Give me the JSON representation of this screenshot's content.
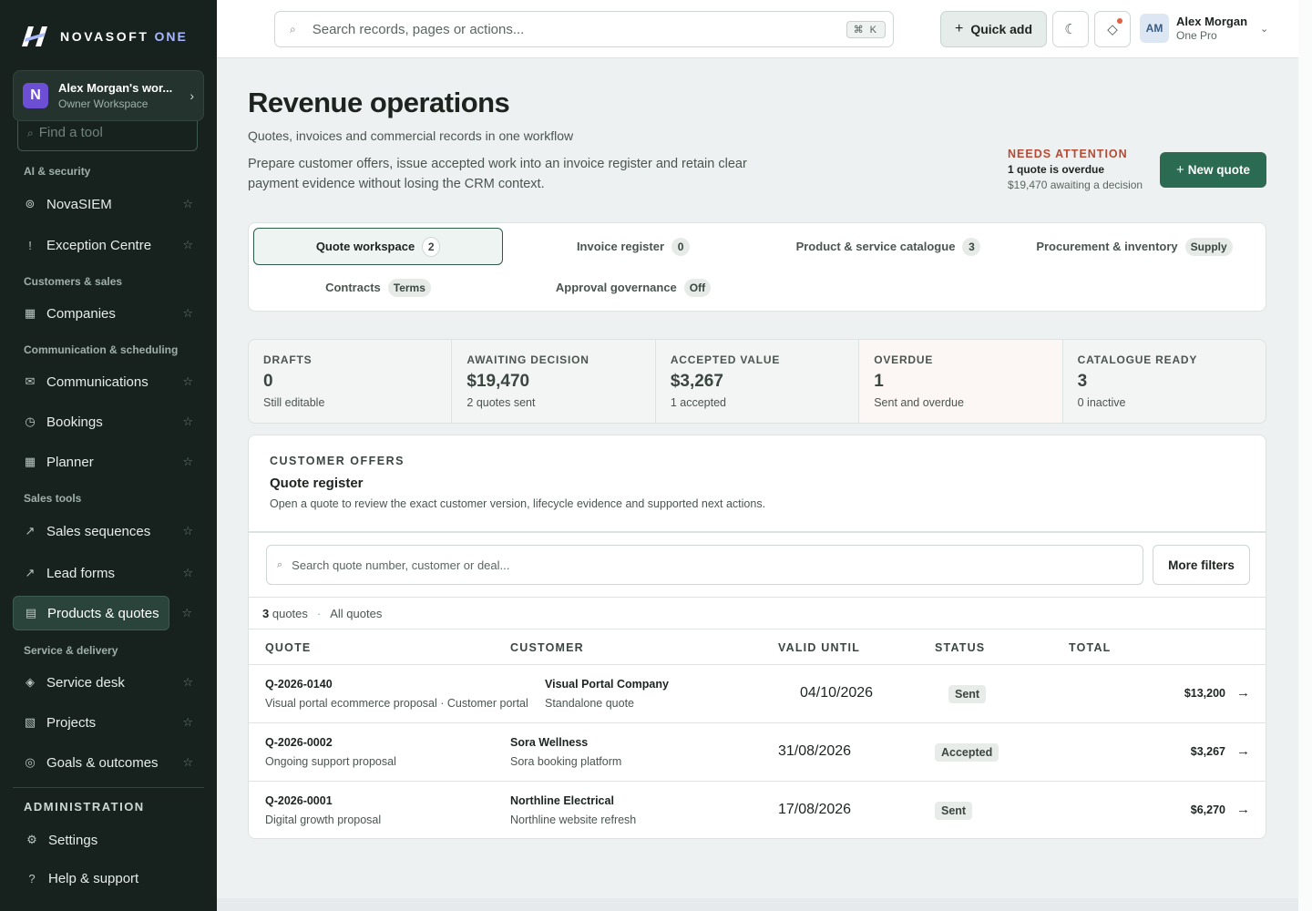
{
  "brand": {
    "name": "NOVASOFT",
    "suffix": "ONE"
  },
  "workspace": {
    "initial": "N",
    "name": "Alex Morgan's wor...",
    "role": "Owner Workspace"
  },
  "sidebar": {
    "find_placeholder": "Find a tool",
    "sections": [
      {
        "title": "AI & security"
      },
      {
        "title": "Customers & sales"
      },
      {
        "title": "Communication & scheduling"
      },
      {
        "title": "Sales tools"
      },
      {
        "title": "Service & delivery"
      }
    ],
    "items": [
      {
        "label": "NovaSIEM",
        "icon": "⊚"
      },
      {
        "label": "Exception Centre",
        "icon": "!"
      },
      {
        "label": "Companies",
        "icon": "▦"
      },
      {
        "label": "Communications",
        "icon": "✉"
      },
      {
        "label": "Bookings",
        "icon": "◷"
      },
      {
        "label": "Planner",
        "icon": "▦"
      },
      {
        "label": "Sales sequences",
        "icon": "↗"
      },
      {
        "label": "Lead forms",
        "icon": "↗"
      },
      {
        "label": "Products & quotes",
        "icon": "▤"
      },
      {
        "label": "Service desk",
        "icon": "◈"
      },
      {
        "label": "Projects",
        "icon": "▧"
      },
      {
        "label": "Goals & outcomes",
        "icon": "◎"
      }
    ],
    "admin": {
      "title": "ADMINISTRATION",
      "items": [
        {
          "label": "Settings",
          "icon": "⚙"
        },
        {
          "label": "Help & support",
          "icon": "?"
        }
      ]
    }
  },
  "topbar": {
    "search_placeholder": "Search records, pages or actions...",
    "shortcut": "⌘ K",
    "quick_add": "Quick add",
    "user": {
      "initials": "AM",
      "name": "Alex Morgan",
      "plan": "One Pro"
    }
  },
  "page": {
    "title": "Revenue operations",
    "subtitle": "Quotes, invoices and commercial records in one workflow",
    "description": "Prepare customer offers, issue accepted work into an invoice register and retain clear payment evidence without losing the CRM context.",
    "attention": {
      "title": "NEEDS ATTENTION",
      "message": "1 quote is overdue",
      "detail": "$19,470 awaiting a decision"
    },
    "new_quote": "New quote"
  },
  "tabs": [
    {
      "label": "Quote workspace",
      "badge": "2",
      "active": true
    },
    {
      "label": "Invoice register",
      "badge": "0"
    },
    {
      "label": "Product & service catalogue",
      "badge": "3"
    },
    {
      "label": "Procurement & inventory",
      "badge": "Supply"
    },
    {
      "label": "Contracts",
      "badge": "Terms"
    },
    {
      "label": "Approval governance",
      "badge": "Off"
    }
  ],
  "stats": [
    {
      "label": "DRAFTS",
      "value": "0",
      "sub": "Still editable"
    },
    {
      "label": "AWAITING DECISION",
      "value": "$19,470",
      "sub": "2 quotes sent"
    },
    {
      "label": "ACCEPTED VALUE",
      "value": "$3,267",
      "sub": "1 accepted"
    },
    {
      "label": "OVERDUE",
      "value": "1",
      "sub": "Sent and overdue"
    },
    {
      "label": "CATALOGUE READY",
      "value": "3",
      "sub": "0 inactive"
    }
  ],
  "register": {
    "kicker": "CUSTOMER OFFERS",
    "title": "Quote register",
    "description": "Open a quote to review the exact customer version, lifecycle evidence and supported next actions.",
    "search_placeholder": "Search quote number, customer or deal...",
    "more_filters": "More filters",
    "count": "3",
    "count_label": "quotes",
    "separator": "·",
    "filter_label": "All quotes",
    "columns": [
      "QUOTE",
      "CUSTOMER",
      "VALID UNTIL",
      "STATUS",
      "TOTAL"
    ],
    "rows": [
      {
        "number": "Q-2026-0140",
        "title": "Visual portal ecommerce proposal · Customer portal",
        "customer": "Visual Portal Company",
        "customer_sub": "Standalone quote",
        "valid_until": "04/10/2026",
        "status": "Sent",
        "total": "$13,200"
      },
      {
        "number": "Q-2026-0002",
        "title": "Ongoing support proposal",
        "customer": "Sora Wellness",
        "customer_sub": "Sora booking platform",
        "valid_until": "31/08/2026",
        "status": "Accepted",
        "total": "$3,267"
      },
      {
        "number": "Q-2026-0001",
        "title": "Digital growth proposal",
        "customer": "Northline Electrical",
        "customer_sub": "Northline website refresh",
        "valid_until": "17/08/2026",
        "status": "Sent",
        "total": "$6,270"
      }
    ]
  }
}
